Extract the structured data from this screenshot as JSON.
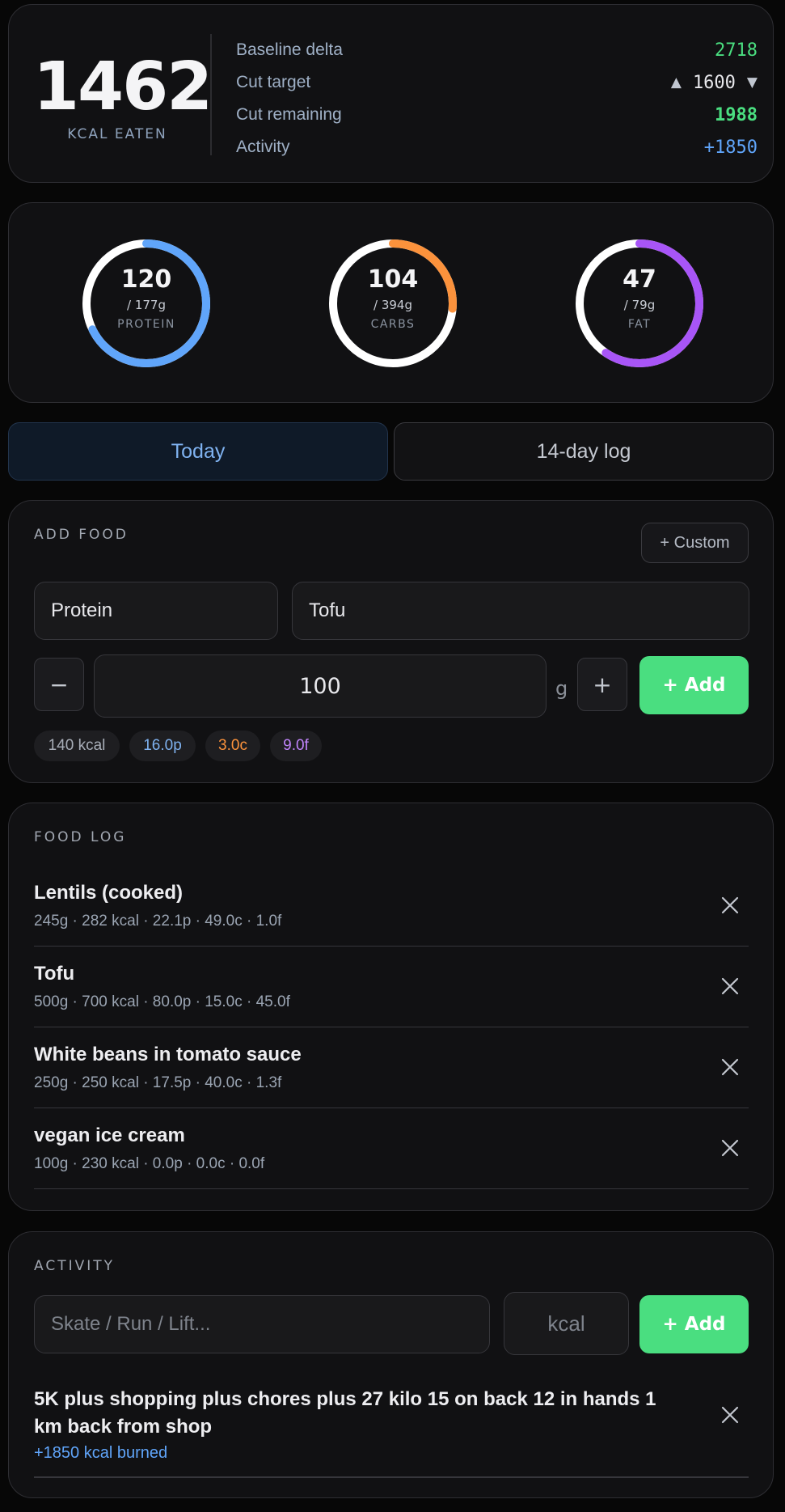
{
  "summary": {
    "kcal_eaten": "1462",
    "kcal_label": "KCAL EATEN",
    "rows": [
      {
        "label": "Baseline delta",
        "value": "2718"
      },
      {
        "label": "Cut target",
        "value": "1600"
      },
      {
        "label": "Cut remaining",
        "value": "1988"
      },
      {
        "label": "Activity",
        "value": "+1850"
      }
    ],
    "stepper_up": "▲",
    "stepper_down": "▼"
  },
  "macros": [
    {
      "value": "120",
      "goal": "/ 177g",
      "label": "PROTEIN",
      "current": 120,
      "target": 177,
      "color": "#60a5fa"
    },
    {
      "value": "104",
      "goal": "/ 394g",
      "label": "CARBS",
      "current": 104,
      "target": 394,
      "color": "#fb923c"
    },
    {
      "value": "47",
      "goal": "/ 79g",
      "label": "FAT",
      "current": 47,
      "target": 79,
      "color": "#a855f7"
    }
  ],
  "tabs": [
    {
      "label": "Today"
    },
    {
      "label": "14-day log"
    }
  ],
  "add_food": {
    "title": "ADD FOOD",
    "custom_label": "+ Custom",
    "category": "Protein",
    "food": "Tofu",
    "minus": "−",
    "grams": "100",
    "unit": "g",
    "plus": "+",
    "add_label": "+ Add",
    "chips": [
      "140 kcal",
      "16.0p",
      "3.0c",
      "9.0f"
    ]
  },
  "food_log": {
    "title": "FOOD LOG",
    "items": [
      {
        "name": "Lentils (cooked)",
        "meta": "245g · 282 kcal · 22.1p · 49.0c · 1.0f"
      },
      {
        "name": "Tofu",
        "meta": "500g · 700 kcal · 80.0p · 15.0c · 45.0f"
      },
      {
        "name": "White beans in tomato sauce",
        "meta": "250g · 250 kcal · 17.5p · 40.0c · 1.3f"
      },
      {
        "name": "vegan ice cream",
        "meta": "100g · 230 kcal · 0.0p · 0.0c · 0.0f"
      }
    ]
  },
  "activity": {
    "title": "ACTIVITY",
    "name_placeholder": "Skate / Run / Lift...",
    "kcal_placeholder": "kcal",
    "add_label": "+ Add",
    "entry_name": "5K plus shopping plus chores plus 27 kilo 15 on back 12 in hands 1 km back from shop",
    "entry_burned": "+1850 kcal burned"
  }
}
